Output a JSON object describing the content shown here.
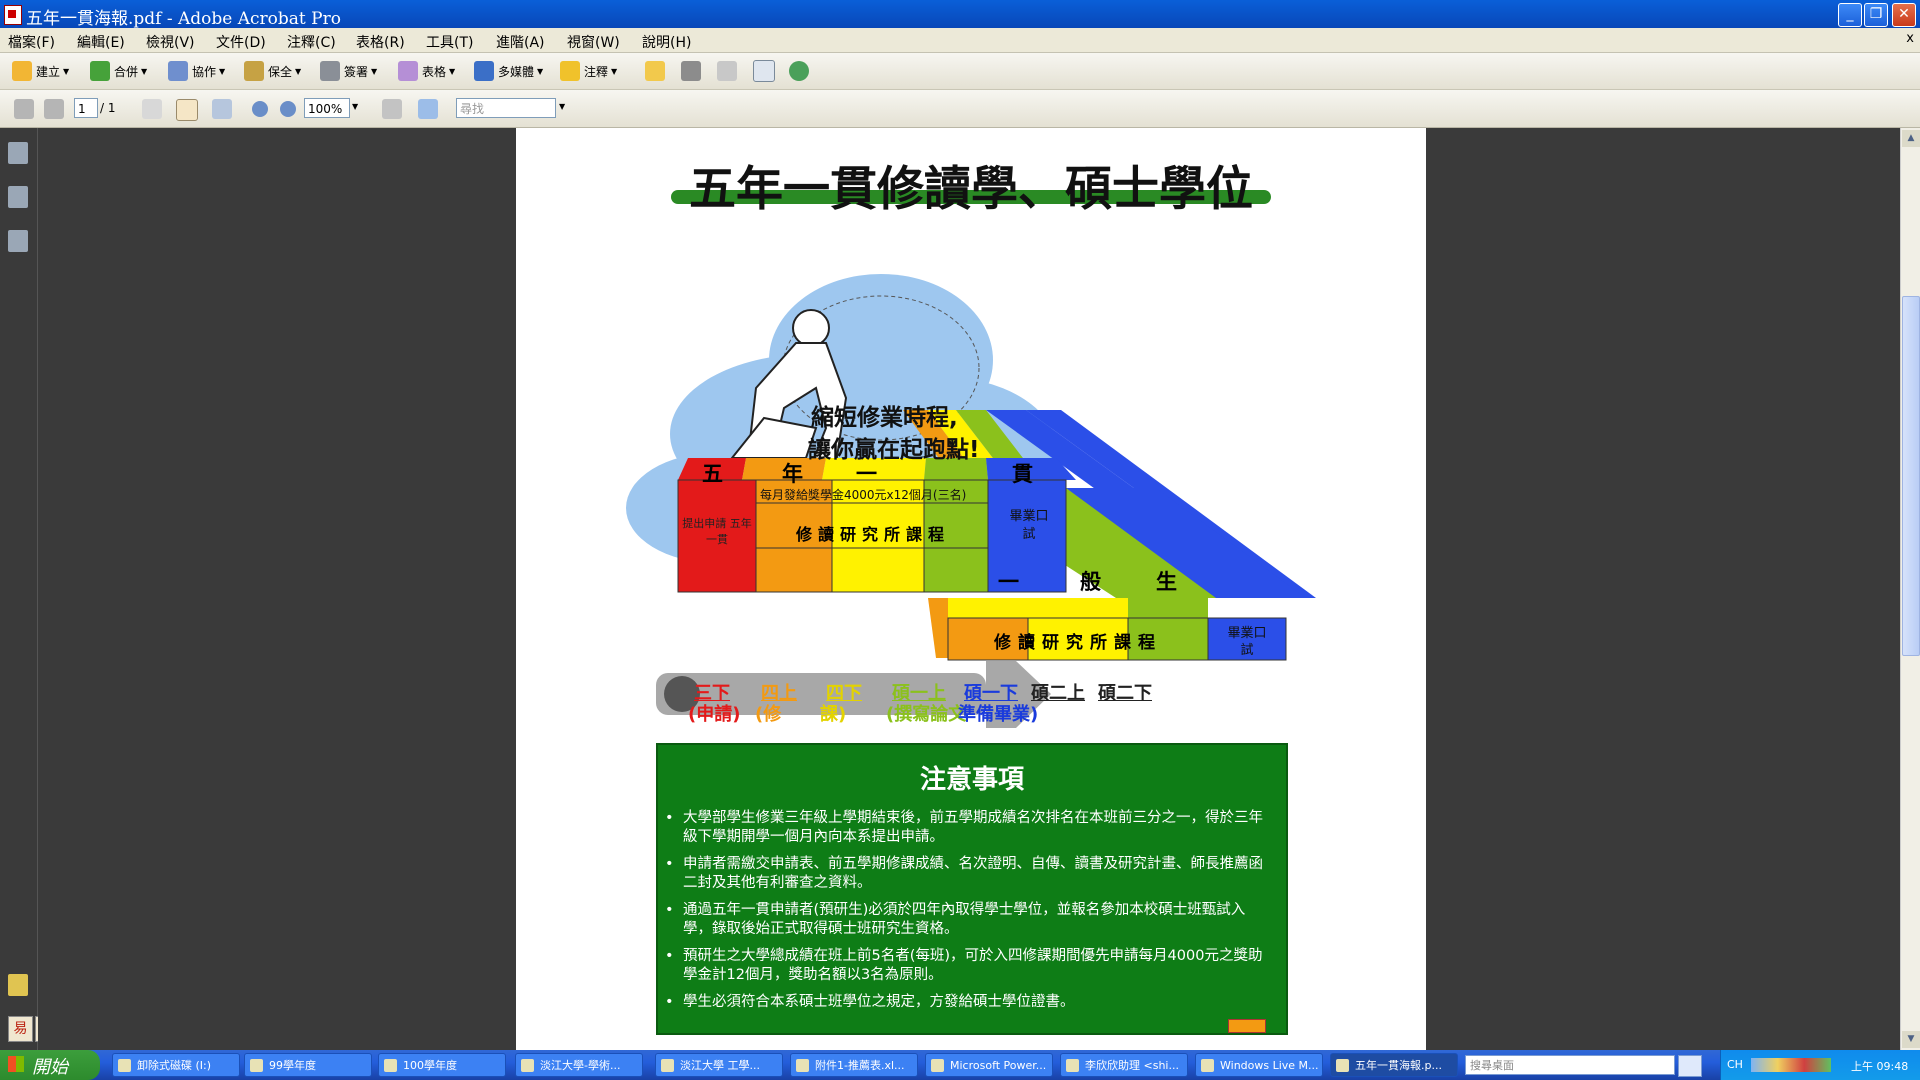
{
  "window": {
    "title": "五年一貫海報.pdf - Adobe Acrobat Pro",
    "min": "_",
    "max": "❐",
    "close": "✕"
  },
  "menu": [
    "檔案(F)",
    "編輯(E)",
    "檢視(V)",
    "文件(D)",
    "注釋(C)",
    "表格(R)",
    "工具(T)",
    "進階(A)",
    "視窗(W)",
    "說明(H)"
  ],
  "menu_close": "x",
  "toolbar": {
    "create": "建立",
    "combine": "合併",
    "collaborate": "協作",
    "secure": "保全",
    "sign": "簽署",
    "forms": "表格",
    "multimedia": "多媒體",
    "comment": "注釋"
  },
  "nav": {
    "page_current": "1",
    "page_total": "/ 1",
    "zoom": "100%",
    "find_placeholder": "尋找"
  },
  "poster": {
    "title": "五年一貫修讀學、碩士學位",
    "bubble_line1": "縮短修業時程,",
    "bubble_line2": "讓你贏在起跑點!",
    "five_year_chars": [
      "五",
      "年",
      "一",
      "貫"
    ],
    "apply_box": "提出申請 五年一貫",
    "scholarship": "每月發給獎學金4000元x12個月(三名)",
    "grad_course": "修讀研究所課程",
    "defense": "畢業口試",
    "general_chars": [
      "一",
      "般",
      "生"
    ],
    "general_course": "修讀研究所課程",
    "general_defense": "畢業口試",
    "timeline": [
      {
        "top": "三下",
        "bottom": "(申請)",
        "color": "#e31a1a"
      },
      {
        "top": "四上",
        "bottom": "(修",
        "color": "#f39a12"
      },
      {
        "top": "四下",
        "bottom": "課)",
        "color": "#e3d300"
      },
      {
        "top": "碩一上",
        "bottom": "(撰寫論文",
        "color": "#8bc11c"
      },
      {
        "top": "碩一下",
        "bottom": "準備畢業)",
        "color": "#1a3bdc"
      },
      {
        "top": "碩二上",
        "bottom": "",
        "color": "#222222"
      },
      {
        "top": "碩二下",
        "bottom": "",
        "color": "#222222"
      }
    ],
    "notes_title": "注意事項",
    "notes": [
      "大學部學生修業三年級上學期結束後，前五學期成績名次排名在本班前三分之一，得於三年級下學期開學一個月內向本系提出申請。",
      "申請者需繳交申請表、前五學期修課成績、名次證明、自傳、讀書及研究計畫、師長推薦函二封及其他有利審查之資料。",
      "通過五年一貫申請者(預研生)必須於四年內取得學士學位，並報名參加本校碩士班甄試入學，錄取後始正式取得碩士班研究生資格。",
      "預研生之大學總成績在班上前5名者(每班)，可於入四修課期間優先申請每月4000元之獎助學金計12個月，獎助名額以3名為原則。",
      "學生必須符合本系碩士班學位之規定，方發給碩士學位證書。"
    ]
  },
  "leftnav_bottom": [
    "易",
    "半"
  ],
  "taskbar": {
    "start": "開始",
    "tasks": [
      "卸除式磁碟 (I:)",
      "99學年度",
      "100學年度",
      "淡江大學-學術...",
      "淡江大學 工學...",
      "附件1-推薦表.xl...",
      "Microsoft Power...",
      "李欣欣助理 <shi...",
      "Windows Live M...",
      "五年一貫海報.p..."
    ],
    "search_placeholder": "搜尋桌面",
    "lang": "CH",
    "clock": "上午 09:48"
  },
  "colors": {
    "red": "#e31a1a",
    "orange": "#f39a12",
    "yellow": "#fff200",
    "green": "#8bc11c",
    "blue": "#2b4fe8",
    "notes_green": "#0e7d16"
  }
}
